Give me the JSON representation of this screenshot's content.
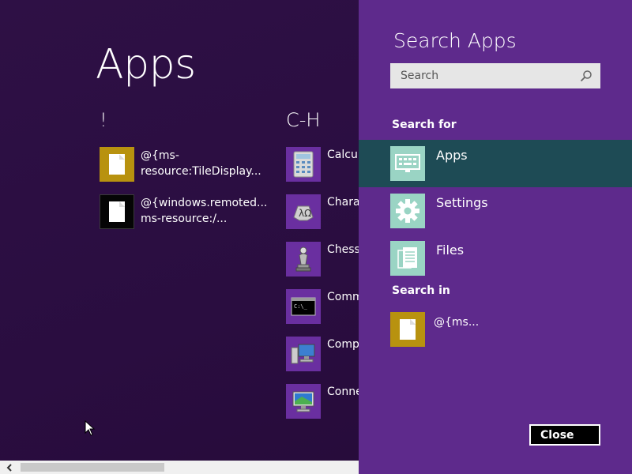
{
  "apps": {
    "title": "Apps",
    "groups": [
      {
        "header": "!",
        "items": [
          {
            "label": "@{ms-\nresource:TileDisplay...",
            "tile": "gold"
          },
          {
            "label": "@{windows.remoted...\nms-resource:/...",
            "tile": "black"
          }
        ]
      },
      {
        "header": "C-H",
        "items": [
          {
            "label": "Calcula",
            "icon": "calculator-icon"
          },
          {
            "label": "Chara",
            "icon": "character-map-icon"
          },
          {
            "label": "Chess",
            "icon": "chess-icon"
          },
          {
            "label": "Comm",
            "icon": "command-prompt-icon"
          },
          {
            "label": "Comp",
            "icon": "computer-icon"
          },
          {
            "label": "Conne",
            "icon": "remote-desktop-icon"
          }
        ]
      }
    ]
  },
  "charm": {
    "title": "Search Apps",
    "search": {
      "placeholder": "Search",
      "value": ""
    },
    "search_for_label": "Search for",
    "scopes": [
      {
        "label": "Apps",
        "icon": "apps-keyboard-icon",
        "selected": true
      },
      {
        "label": "Settings",
        "icon": "settings-gear-icon",
        "selected": false
      },
      {
        "label": "Files",
        "icon": "files-icon",
        "selected": false
      }
    ],
    "search_in_label": "Search in",
    "search_in_item": {
      "label": "@{ms...",
      "icon": "document-icon"
    },
    "close_label": "Close"
  },
  "colors": {
    "background": "#2a0f3d",
    "charm": "#5e2a8c",
    "selected_scope": "#1e4b55",
    "scope_tile": "#9ad4c4",
    "gold_tile": "#b8920f",
    "app_tile": "#6a2fa0"
  }
}
